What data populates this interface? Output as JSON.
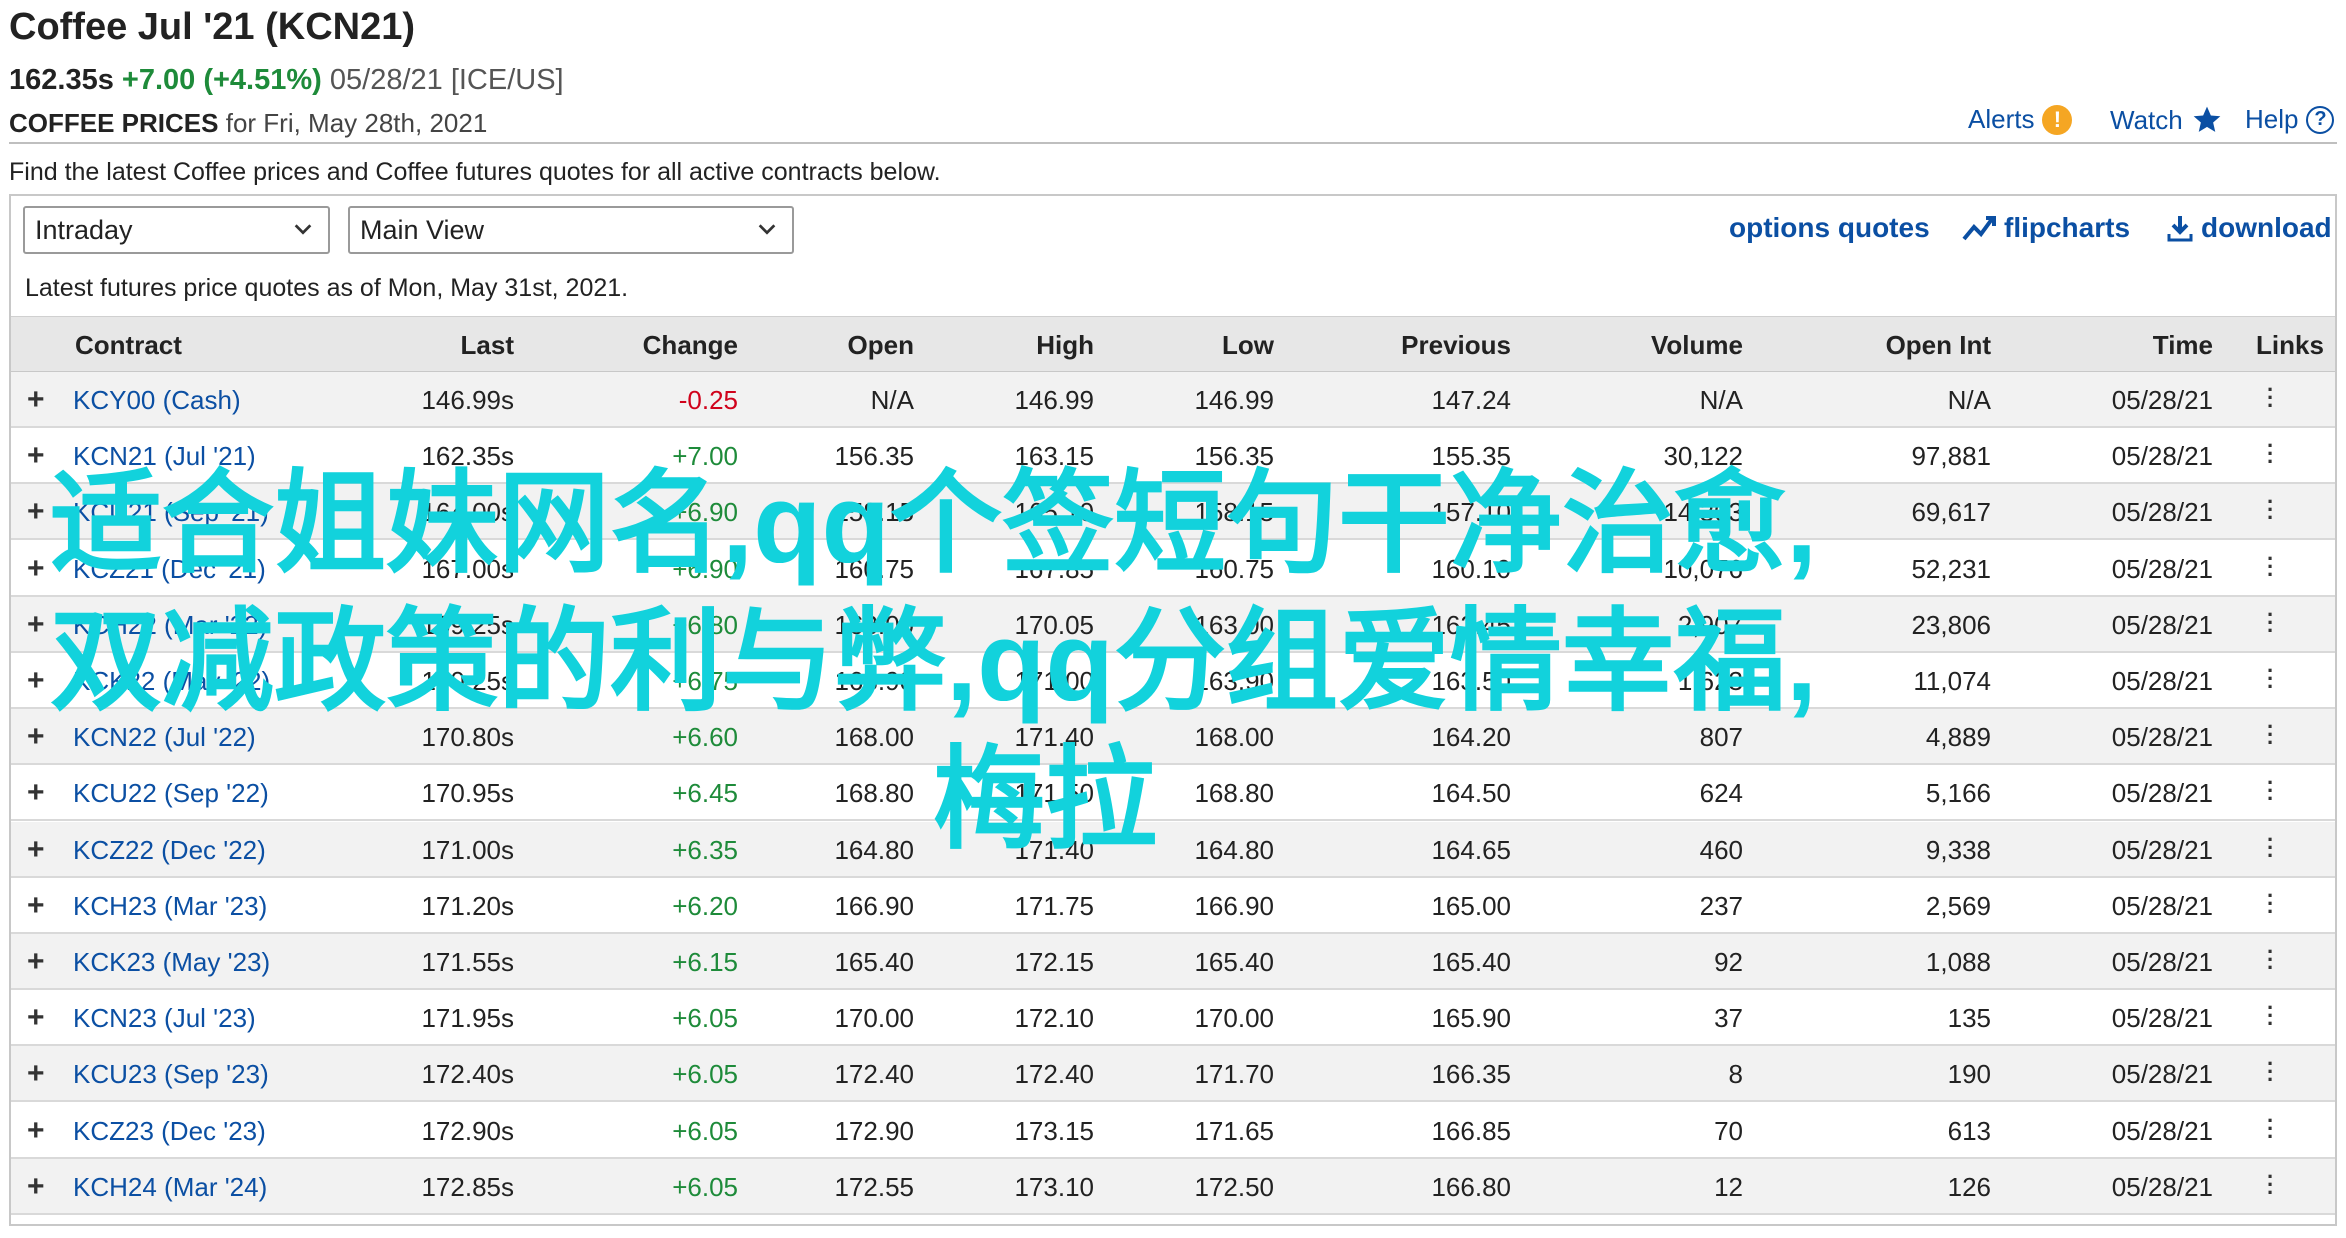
{
  "header": {
    "title": "Coffee Jul '21 (KCN21)",
    "last": "162.35s",
    "change": "+7.00 (+4.51%)",
    "meta": "05/28/21 [ICE/US]",
    "section_label": "COFFEE PRICES",
    "section_date": "for Fri, May 28th, 2021"
  },
  "top_links": {
    "alerts": "Alerts",
    "watch": "Watch",
    "help": "Help"
  },
  "intro": "Find the latest Coffee prices and Coffee futures quotes for all active contracts below.",
  "controls": {
    "interval_select": "Intraday",
    "view_select": "Main View",
    "options_quotes": "options quotes",
    "flipcharts": "flipcharts",
    "download": "download"
  },
  "as_of": "Latest futures price quotes as of Mon, May 31st, 2021.",
  "columns": [
    "Contract",
    "Last",
    "Change",
    "Open",
    "High",
    "Low",
    "Previous",
    "Volume",
    "Open Int",
    "Time",
    "Links"
  ],
  "rows": [
    {
      "contract": "KCY00 (Cash)",
      "last": "146.99s",
      "change": "-0.25",
      "open": "N/A",
      "high": "146.99",
      "low": "146.99",
      "previous": "147.24",
      "volume": "N/A",
      "open_int": "N/A",
      "time": "05/28/21"
    },
    {
      "contract": "KCN21 (Jul '21)",
      "last": "162.35s",
      "change": "+7.00",
      "open": "156.35",
      "high": "163.15",
      "low": "156.35",
      "previous": "155.35",
      "volume": "30,122",
      "open_int": "97,881",
      "time": "05/28/21"
    },
    {
      "contract": "KCU21 (Sep '21)",
      "last": "164.00s",
      "change": "+6.90",
      "open": "158.15",
      "high": "165.10",
      "low": "158.15",
      "previous": "157.10",
      "volume": "14,303",
      "open_int": "69,617",
      "time": "05/28/21"
    },
    {
      "contract": "KCZ21 (Dec '21)",
      "last": "167.00s",
      "change": "+6.90",
      "open": "160.75",
      "high": "167.85",
      "low": "160.75",
      "previous": "160.10",
      "volume": "10,076",
      "open_int": "52,231",
      "time": "05/28/21"
    },
    {
      "contract": "KCH22 (Mar '22)",
      "last": "169.25s",
      "change": "+6.80",
      "open": "163.00",
      "high": "170.05",
      "low": "163.00",
      "previous": "162.45",
      "volume": "2,907",
      "open_int": "23,806",
      "time": "05/28/21"
    },
    {
      "contract": "KCK22 (May '22)",
      "last": "170.25s",
      "change": "+6.75",
      "open": "163.90",
      "high": "171.00",
      "low": "163.90",
      "previous": "163.50",
      "volume": "1,623",
      "open_int": "11,074",
      "time": "05/28/21"
    },
    {
      "contract": "KCN22 (Jul '22)",
      "last": "170.80s",
      "change": "+6.60",
      "open": "168.00",
      "high": "171.40",
      "low": "168.00",
      "previous": "164.20",
      "volume": "807",
      "open_int": "4,889",
      "time": "05/28/21"
    },
    {
      "contract": "KCU22 (Sep '22)",
      "last": "170.95s",
      "change": "+6.45",
      "open": "168.80",
      "high": "171.50",
      "low": "168.80",
      "previous": "164.50",
      "volume": "624",
      "open_int": "5,166",
      "time": "05/28/21"
    },
    {
      "contract": "KCZ22 (Dec '22)",
      "last": "171.00s",
      "change": "+6.35",
      "open": "164.80",
      "high": "171.40",
      "low": "164.80",
      "previous": "164.65",
      "volume": "460",
      "open_int": "9,338",
      "time": "05/28/21"
    },
    {
      "contract": "KCH23 (Mar '23)",
      "last": "171.20s",
      "change": "+6.20",
      "open": "166.90",
      "high": "171.75",
      "low": "166.90",
      "previous": "165.00",
      "volume": "237",
      "open_int": "2,569",
      "time": "05/28/21"
    },
    {
      "contract": "KCK23 (May '23)",
      "last": "171.55s",
      "change": "+6.15",
      "open": "165.40",
      "high": "172.15",
      "low": "165.40",
      "previous": "165.40",
      "volume": "92",
      "open_int": "1,088",
      "time": "05/28/21"
    },
    {
      "contract": "KCN23 (Jul '23)",
      "last": "171.95s",
      "change": "+6.05",
      "open": "170.00",
      "high": "172.10",
      "low": "170.00",
      "previous": "165.90",
      "volume": "37",
      "open_int": "135",
      "time": "05/28/21"
    },
    {
      "contract": "KCU23 (Sep '23)",
      "last": "172.40s",
      "change": "+6.05",
      "open": "172.40",
      "high": "172.40",
      "low": "171.70",
      "previous": "166.35",
      "volume": "8",
      "open_int": "190",
      "time": "05/28/21"
    },
    {
      "contract": "KCZ23 (Dec '23)",
      "last": "172.90s",
      "change": "+6.05",
      "open": "172.90",
      "high": "173.15",
      "low": "171.65",
      "previous": "166.85",
      "volume": "70",
      "open_int": "613",
      "time": "05/28/21"
    },
    {
      "contract": "KCH24 (Mar '24)",
      "last": "172.85s",
      "change": "+6.05",
      "open": "172.55",
      "high": "173.10",
      "low": "172.50",
      "previous": "166.80",
      "volume": "12",
      "open_int": "126",
      "time": "05/28/21"
    }
  ],
  "overlay_text": {
    "line1": "适合姐妹网名,qq个签短句干净治愈,",
    "line2": "双减政策的利与弊,qq分组爱情幸福,",
    "line3": "梅拉"
  },
  "colors": {
    "link": "#0b4fa3",
    "positive": "#1e8b3a",
    "negative": "#d0021b",
    "overlay": "#12d2dc",
    "alert": "#f5a623"
  }
}
